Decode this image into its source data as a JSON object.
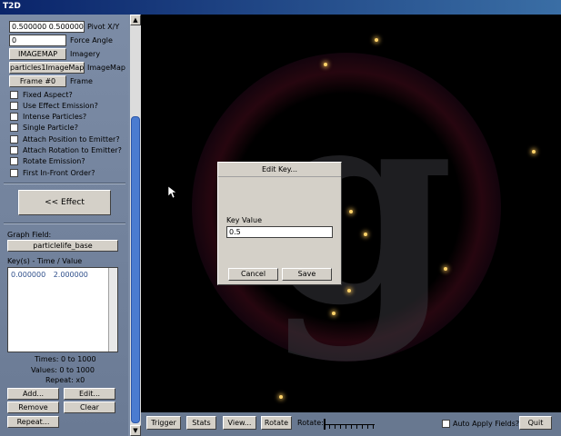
{
  "window": {
    "title": "T2D"
  },
  "panel": {
    "pivot": {
      "value": "0.500000 0.500000",
      "label": "Pivot X/Y"
    },
    "force_angle": {
      "value": "0",
      "label": "Force Angle"
    },
    "imagery": {
      "button": "IMAGEMAP",
      "label": "Imagery"
    },
    "imagemap": {
      "button": "particles1ImageMap",
      "label": "ImageMap"
    },
    "frame": {
      "button": "Frame #0",
      "label": "Frame"
    },
    "checkboxes": [
      {
        "label": "Fixed Aspect?",
        "checked": false
      },
      {
        "label": "Use Effect Emission?",
        "checked": false
      },
      {
        "label": "Intense Particles?",
        "checked": false
      },
      {
        "label": "Single Particle?",
        "checked": false
      },
      {
        "label": "Attach Position to Emitter?",
        "checked": false
      },
      {
        "label": "Attach Rotation to Emitter?",
        "checked": false
      },
      {
        "label": "Rotate Emission?",
        "checked": false
      },
      {
        "label": "First In-Front Order?",
        "checked": false
      }
    ],
    "effect_button": "<< Effect",
    "graph_field": {
      "label": "Graph Field:",
      "value": "particlelife_base"
    },
    "keys": {
      "label": "Key(s) - Time / Value",
      "rows": [
        {
          "time": "0.000000",
          "value": "2.000000"
        }
      ]
    },
    "times": "Times: 0 to 1000",
    "values": "Values: 0 to 1000",
    "repeat": "Repeat: x0",
    "buttons": {
      "add": "Add...",
      "edit": "Edit...",
      "remove": "Remove",
      "clear": "Clear",
      "repeat": "Repeat..."
    }
  },
  "bottombar": {
    "trigger": "Trigger",
    "stats": "Stats",
    "view": "View...",
    "rotate_button": "Rotate",
    "rotate_label": "Rotate:",
    "auto_apply": "Auto Apply Fields?",
    "auto_apply_checked": false,
    "quit": "Quit"
  },
  "dialog": {
    "title": "Edit Key...",
    "field_label": "Key Value",
    "field_value": "0.5",
    "cancel": "Cancel",
    "save": "Save"
  },
  "colors": {
    "particle": "#ffd36a",
    "titlebar": "#0a246a",
    "scroll_thumb": "#4a7bd0"
  }
}
